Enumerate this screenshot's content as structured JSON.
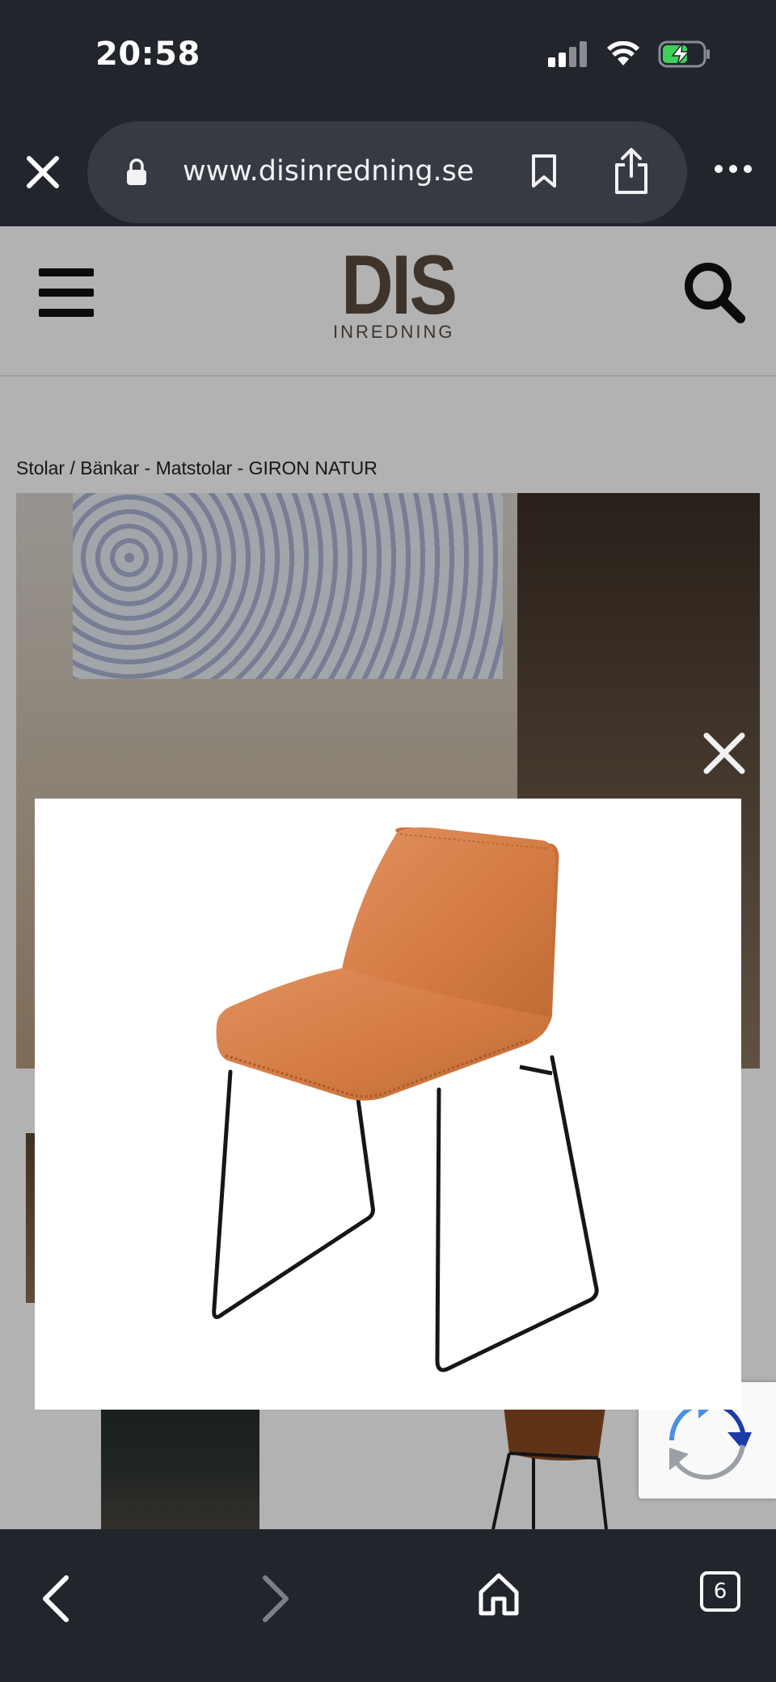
{
  "status_bar": {
    "time": "20:58",
    "icons": [
      "cellular-signal-icon",
      "wifi-icon",
      "battery-charging-icon"
    ]
  },
  "browser": {
    "url": "www.disinredning.se",
    "open_tabs_count": "6",
    "toolbar_icons": [
      "back-icon",
      "forward-icon",
      "home-icon",
      "tabs-icon"
    ],
    "url_bar_icons": [
      "close-icon",
      "lock-icon",
      "bookmark-icon",
      "share-icon",
      "more-icon"
    ]
  },
  "site": {
    "logo": {
      "main": "DIS",
      "sub": "INREDNING"
    },
    "breadcrumb": "Stolar / Bänkar - Matstolar - GIRON NATUR",
    "colors": {
      "logo_brown": "#5b4b3f",
      "chair_leather": "#d9804a",
      "overlay": "rgba(0,0,0,0.30)"
    }
  },
  "lightbox": {
    "image_subject": "Leather dining chair with black metal sled legs",
    "close_icon": "close-icon"
  },
  "recaptcha": {
    "icon": "recaptcha-icon"
  }
}
